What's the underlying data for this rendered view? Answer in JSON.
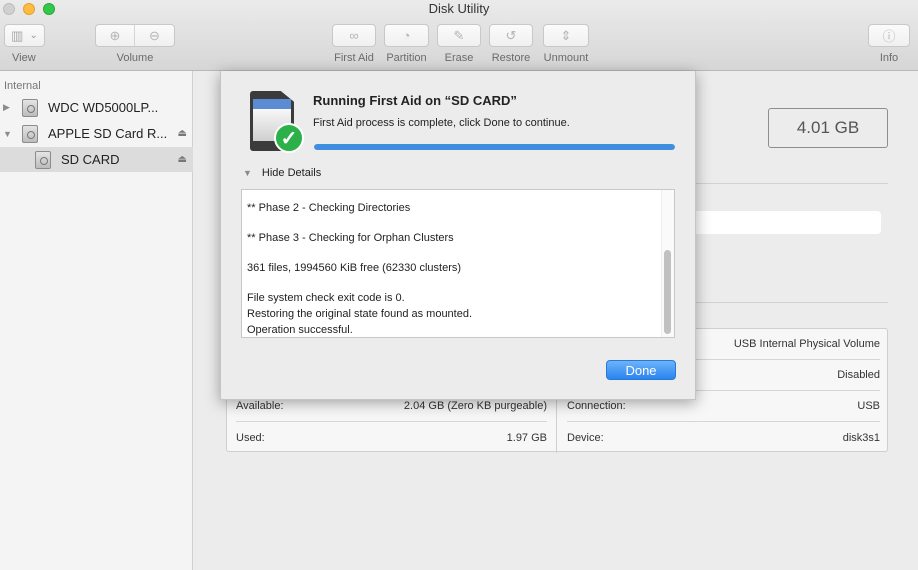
{
  "window": {
    "title": "Disk Utility"
  },
  "toolbar": {
    "view": {
      "label": "View",
      "icon": "sidebar-toggle-icon",
      "chevron": "chevron-down-icon"
    },
    "volume": {
      "label": "Volume",
      "add_icon": "add-volume-icon",
      "remove_icon": "remove-volume-icon"
    },
    "first_aid": {
      "label": "First Aid",
      "icon": "stethoscope-icon"
    },
    "partition": {
      "label": "Partition",
      "icon": "pie-chart-icon"
    },
    "erase": {
      "label": "Erase",
      "icon": "erase-icon"
    },
    "restore": {
      "label": "Restore",
      "icon": "restore-icon"
    },
    "unmount": {
      "label": "Unmount",
      "icon": "unmount-icon"
    },
    "info": {
      "label": "Info",
      "icon": "info-icon"
    }
  },
  "glyphs": {
    "view": "▥",
    "chevron": "⌄",
    "add_volume": "⊕",
    "remove_volume": "⊖",
    "first_aid": "∞",
    "partition": "◔",
    "erase": "✎",
    "restore": "↺",
    "unmount": "⇕",
    "info": "ⓘ",
    "collapsed": "▶",
    "expanded": "▼",
    "eject": "⏏",
    "check": "✓"
  },
  "sidebar": {
    "section_label": "Internal",
    "items": [
      {
        "label": "WDC WD5000LP...",
        "expanded": false,
        "eject": false,
        "selected": false
      },
      {
        "label": "APPLE SD Card R...",
        "expanded": true,
        "eject": true,
        "selected": false
      },
      {
        "label": "SD CARD",
        "eject": true,
        "selected": true
      }
    ]
  },
  "main": {
    "capacity": "4.01 GB",
    "info_left": [
      {
        "label": "Available:",
        "value": "2.04 GB (Zero KB purgeable)"
      },
      {
        "label": "Used:",
        "value": "1.97 GB"
      }
    ],
    "info_right": [
      {
        "label": "",
        "value": "USB Internal Physical Volume"
      },
      {
        "label": "",
        "value": "Disabled"
      },
      {
        "label": "Connection:",
        "value": "USB"
      },
      {
        "label": "Device:",
        "value": "disk3s1"
      }
    ]
  },
  "sheet": {
    "title": "Running First Aid on “SD CARD”",
    "message": "First Aid process is complete, click Done to continue.",
    "progress_percent": 100,
    "details_toggle_label": "Hide Details",
    "log_lines": [
      "** Phase 2 - Checking Directories",
      "** Phase 3 - Checking for Orphan Clusters",
      "361 files, 1994560 KiB free (62330 clusters)",
      "File system check exit code is 0.",
      "Restoring the original state found as mounted.",
      "Operation successful."
    ],
    "done_label": "Done"
  },
  "colors": {
    "accent": "#3f8ee0",
    "success": "#2cb14a",
    "button_blue": "#2a84f0"
  }
}
